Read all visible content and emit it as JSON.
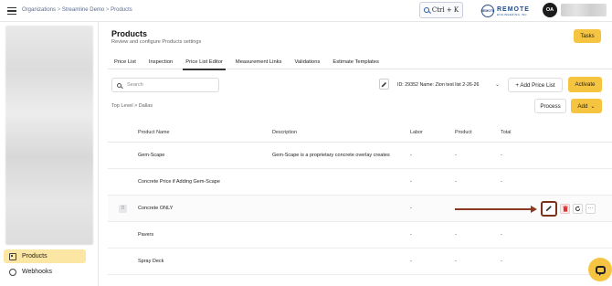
{
  "header": {
    "breadcrumb": [
      "Organizations",
      "Streamline Demo",
      "Products"
    ],
    "breadcrumb_sep": ">",
    "search_shortcut": "Ctrl + K",
    "logo_text": "REMOTE",
    "logo_subtext": "ENGINEERING INC",
    "logo_badge": "REMOTE",
    "user_initials": "OA"
  },
  "sidebar": {
    "items": [
      {
        "label": "Products",
        "active": true,
        "icon": "box-icon"
      },
      {
        "label": "Webhooks",
        "active": false,
        "icon": "webhook-icon"
      }
    ]
  },
  "page": {
    "title": "Products",
    "subtitle": "Review and configure Products settings",
    "tasks_label": "Tasks"
  },
  "tabs": [
    {
      "label": "Price List",
      "active": false
    },
    {
      "label": "Inspection",
      "active": false
    },
    {
      "label": "Price List Editor",
      "active": true
    },
    {
      "label": "Measurement Links",
      "active": false
    },
    {
      "label": "Validations",
      "active": false
    },
    {
      "label": "Estimate Templates",
      "active": false
    }
  ],
  "toolbar": {
    "search_placeholder": "Search",
    "price_list_value": "ID: 29352 Name: Zion test list 2-26-26",
    "add_price_list_label": "+ Add Price List",
    "activate_label": "Activate",
    "process_label": "Process",
    "add_label": "Add",
    "crumbs": "Top Level  >  Dallas"
  },
  "table": {
    "headers": {
      "name": "Product Name",
      "description": "Description",
      "labor": "Labor",
      "product": "Product",
      "total": "Total"
    },
    "rows": [
      {
        "name": "Gem-Scape",
        "description": "Gem-Scape is a proprietary concrete overlay creates",
        "labor": "-",
        "product": "-",
        "total": "-"
      },
      {
        "name": "Concrete Price if Adding Gem-Scape",
        "description": "",
        "labor": "-",
        "product": "-",
        "total": "-"
      },
      {
        "name": "Concrete ONLY",
        "description": "",
        "labor": "-",
        "product": "-",
        "total": "-"
      },
      {
        "name": "Pavers",
        "description": "",
        "labor": "-",
        "product": "-",
        "total": "-"
      },
      {
        "name": "Spray Deck",
        "description": "",
        "labor": "-",
        "product": "-",
        "total": "-"
      }
    ]
  },
  "colors": {
    "accent": "#f5c542",
    "highlight_box": "#7a3318",
    "arrow": "#8a3a22"
  }
}
